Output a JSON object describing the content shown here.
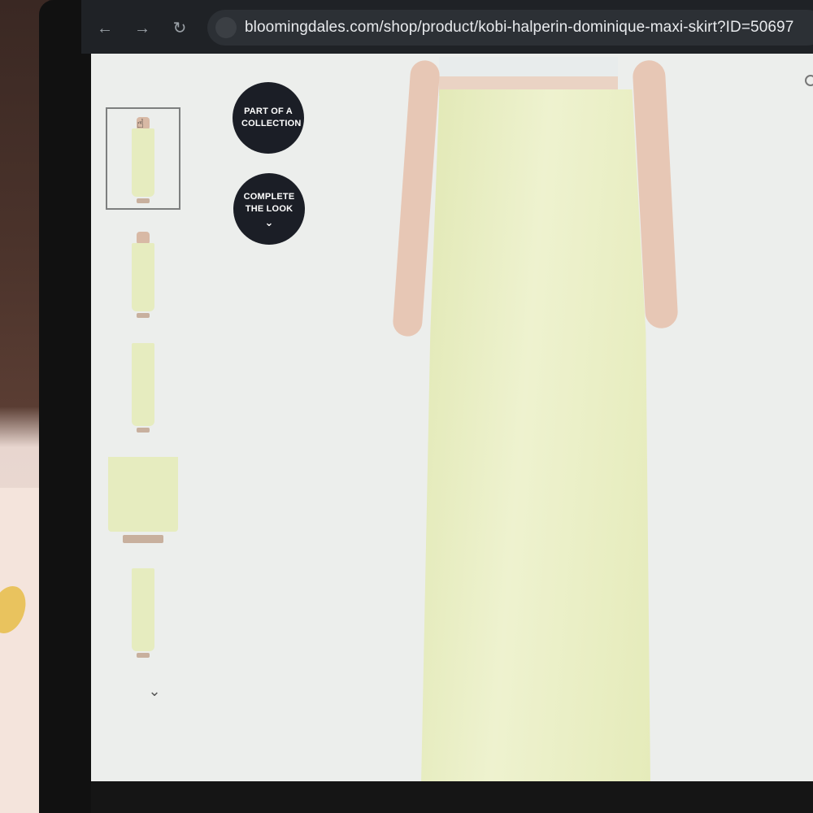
{
  "browser": {
    "back_icon": "arrow-left-icon",
    "forward_icon": "arrow-right-icon",
    "reload_icon": "reload-icon",
    "site_info_icon": "site-settings-icon",
    "url": "bloomingdales.com/shop/product/kobi-halperin-dominique-maxi-skirt?ID=50697"
  },
  "product": {
    "badges": {
      "collection_label": "PART OF A COLLECTION",
      "complete_label": "COMPLETE THE LOOK",
      "complete_icon": "chevron-down-icon"
    },
    "thumbnails": [
      {
        "alt": "front view",
        "active": true
      },
      {
        "alt": "side view",
        "active": false
      },
      {
        "alt": "back view",
        "active": false
      },
      {
        "alt": "detail hem view",
        "active": false
      },
      {
        "alt": "full length view",
        "active": false
      }
    ],
    "thumbnails_more_icon": "chevron-down-icon",
    "colors": {
      "skirt": "#e6ecbf",
      "badge_bg": "#1b1e26",
      "page_bg": "#eceeec"
    }
  }
}
